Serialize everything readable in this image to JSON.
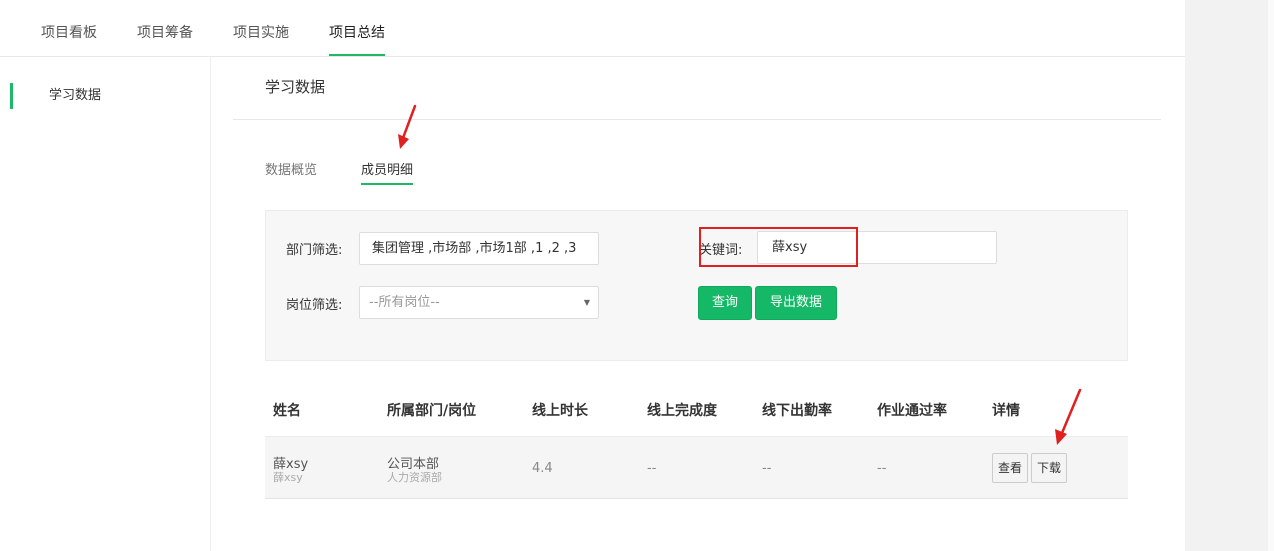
{
  "top_tabs": [
    {
      "label": "项目看板"
    },
    {
      "label": "项目筹备"
    },
    {
      "label": "项目实施"
    },
    {
      "label": "项目总结"
    }
  ],
  "sidebar": {
    "items": [
      {
        "label": "学习数据"
      }
    ]
  },
  "main": {
    "title": "学习数据",
    "sub_tabs": [
      {
        "label": "数据概览"
      },
      {
        "label": "成员明细"
      }
    ]
  },
  "filters": {
    "dept_label": "部门筛选:",
    "dept_value": "集团管理 ,市场部 ,市场1部 ,1 ,2 ,3",
    "keyword_label": "关键词:",
    "keyword_value": "薛xsy",
    "position_label": "岗位筛选:",
    "position_value": "--所有岗位--",
    "query_button": "查询",
    "export_button": "导出数据"
  },
  "table": {
    "headers": [
      "姓名",
      "所属部门/岗位",
      "线上时长",
      "线上完成度",
      "线下出勤率",
      "作业通过率",
      "详情"
    ],
    "rows": [
      {
        "name": "薛xsy",
        "username": "薛xsy",
        "dept": "公司本部",
        "post": "人力资源部",
        "online_hours": "4.4",
        "online_completion": "--",
        "offline_attendance": "--",
        "homework_pass": "--",
        "view_button": "查看",
        "download_button": "下载"
      }
    ]
  },
  "colors": {
    "accent": "#1fb866",
    "button_green": "#14b866",
    "annotation_red": "#e02020"
  },
  "icons": {
    "select_caret": "caret-down-icon",
    "annotation": "red-arrow-icon"
  }
}
